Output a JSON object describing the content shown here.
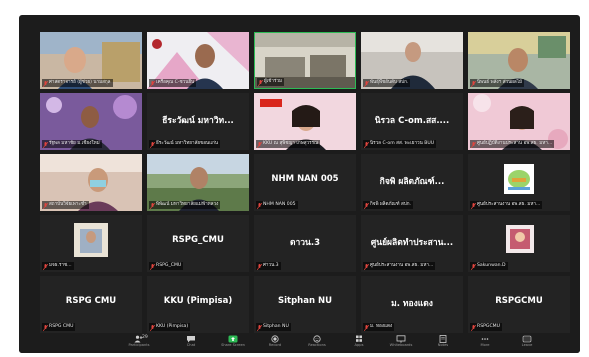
{
  "meeting": {
    "tiles": [
      {
        "name": "ศาสตราจารย์ (ผู้ช่วย) นามสกุล",
        "big": ""
      },
      {
        "name": "เครือคุณ C-ชวนยืน",
        "big": ""
      },
      {
        "name": "ผู้เข้าร่วม",
        "big": ""
      },
      {
        "name": "พันธุ์พืชอันดับ สปก.",
        "big": ""
      },
      {
        "name": "นิพนธ์ พลังฯ ส่วนผลไม้",
        "big": ""
      },
      {
        "name": "รัฐพล มหาชัย ม.เชียงใหม่",
        "big": ""
      },
      {
        "name": "ธีระวัฒน์ มหาวิทยาลัยขอนแก่น",
        "big": "ธีระวัฒน์ มหาวิท..."
      },
      {
        "name": "KKU ณ สุพิชญา เกษสุวรรณ",
        "big": ""
      },
      {
        "name": "นิรวล C-om สส. พะเยาวน BUU",
        "big": "นิรวล C-om.สส...."
      },
      {
        "name": "ศูนย์ปฏิบัติงานประสาน อพ.สธ. มหา...",
        "big": ""
      },
      {
        "name": "สถาบันวิจัยเพาะชำ",
        "big": ""
      },
      {
        "name": "พิพัฒน์ มหาวิทยาลัยแม่ฟ้าหลวง",
        "big": ""
      },
      {
        "name": "NHM NAN 005",
        "big": "NHM NAN 005"
      },
      {
        "name": "กิจพิ ผลิตภัณฑ์ สปก.",
        "big": "กิจพิ ผลิตภัณฑ์..."
      },
      {
        "name": "ศูนย์ประสานงาน อพ.สธ. มหา...",
        "big": ""
      },
      {
        "name": "มจธ.ราช...",
        "big": ""
      },
      {
        "name": "RSPG_CMU",
        "big": "RSPG_CMU"
      },
      {
        "name": "ศาวน.3",
        "big": "ดาวน.3"
      },
      {
        "name": "ศูนย์ประสานงาน อพ.สธ. มหา...",
        "big": "ศูนย์ผลิตทำประสาน..."
      },
      {
        "name": "Sakunwan.D",
        "big": ""
      },
      {
        "name": "RSPG CMU",
        "big": "RSPG CMU"
      },
      {
        "name": "KKU (Pimpisa)",
        "big": "KKU (Pimpisa)"
      },
      {
        "name": "Sitphan NU",
        "big": "Sitphan NU"
      },
      {
        "name": "ม. ทองแดง",
        "big": "ม. ทองแดง"
      },
      {
        "name": "RSPGCMU",
        "big": "RSPGCMU"
      }
    ]
  },
  "toolbar": {
    "participants_count": "29",
    "items": [
      {
        "icon": "participants-icon",
        "label": "Participants"
      },
      {
        "icon": "chat-icon",
        "label": "Chat"
      },
      {
        "icon": "share-screen-icon",
        "label": "Share Screen"
      },
      {
        "icon": "record-icon",
        "label": "Record"
      },
      {
        "icon": "reactions-icon",
        "label": "Reactions"
      },
      {
        "icon": "apps-icon",
        "label": "Apps"
      },
      {
        "icon": "whiteboards-icon",
        "label": "Whiteboards"
      },
      {
        "icon": "notes-icon",
        "label": "Notes"
      },
      {
        "icon": "more-icon",
        "label": "More"
      },
      {
        "icon": "leave-icon",
        "label": "Leave"
      }
    ]
  },
  "colors": {
    "window_bg": "#1c1c1c",
    "tile_bg": "#232323",
    "muted_mic": "#e0443e",
    "share_green": "#2dbb55"
  }
}
